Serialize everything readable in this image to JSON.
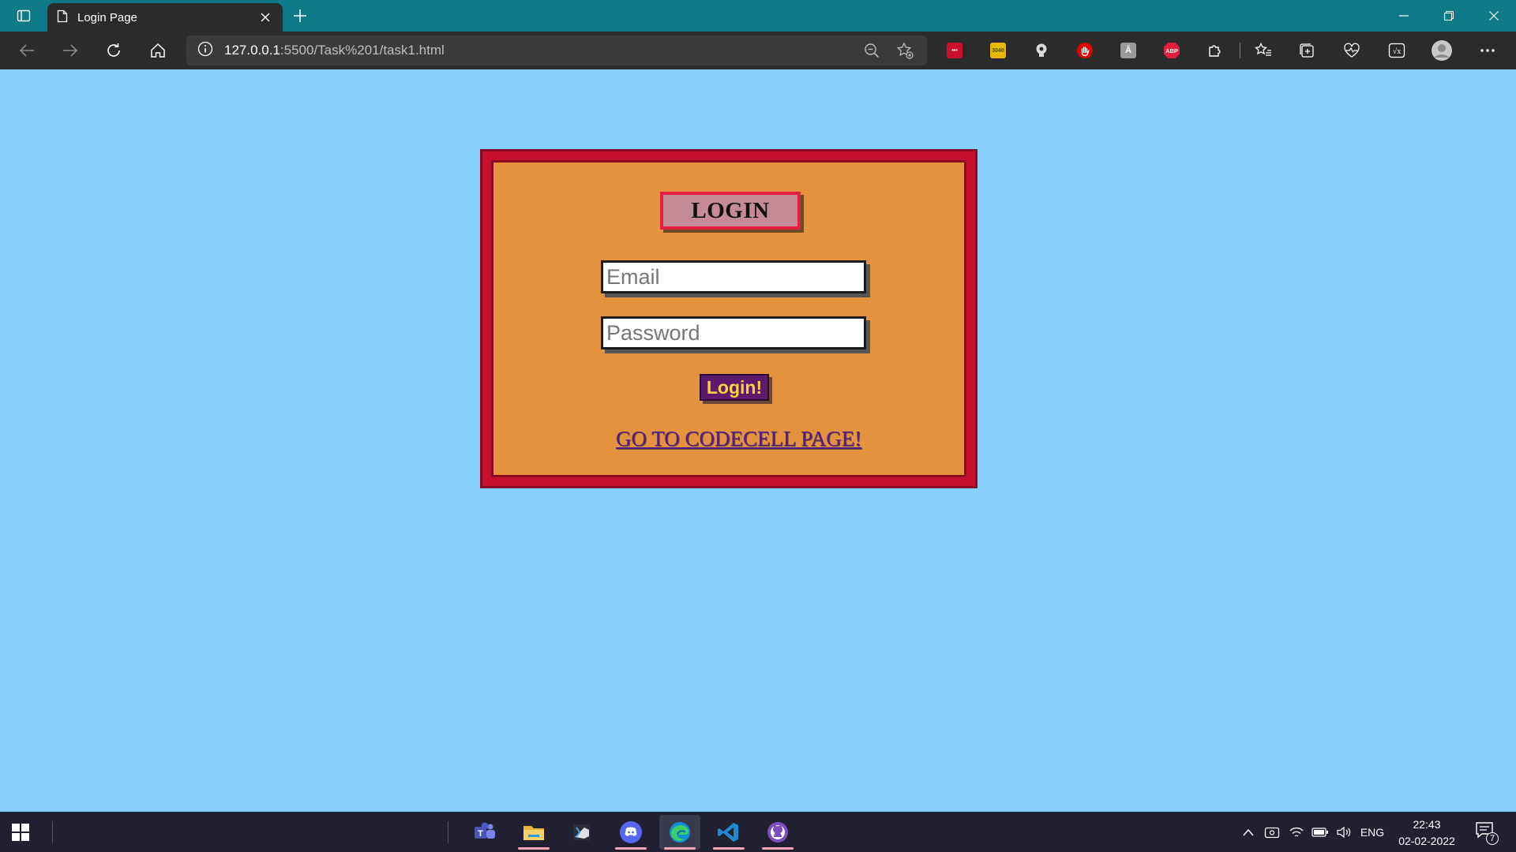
{
  "browser": {
    "tab_title": "Login Page",
    "url_host": "127.0.0.1",
    "url_rest": ":5500/Task%201/task1.html",
    "theme_color": "#0e7a87"
  },
  "extensions": [
    {
      "name": "extension-red-icon",
      "label": "•••",
      "color": "#c8102e"
    },
    {
      "name": "extension-yellow-icon",
      "label": "3040",
      "color": "#e6b800"
    },
    {
      "name": "extension-bulb-icon",
      "label": "",
      "color": "#cfcfcf"
    },
    {
      "name": "extension-hand-icon",
      "label": "",
      "color": "#e00000"
    },
    {
      "name": "extension-translate-icon",
      "label": "A",
      "color": "#9a9a9a"
    },
    {
      "name": "extension-adblock-icon",
      "label": "ABP",
      "color": "#e0203a"
    }
  ],
  "login": {
    "title": "LOGIN",
    "email_placeholder": "Email",
    "password_placeholder": "Password",
    "button_label": "Login!",
    "link_text": "GO TO CODECELL PAGE!",
    "colors": {
      "page_bg": "#87CEFA",
      "box_bg": "#E4923D",
      "box_border": "#c8102e",
      "button_bg": "#5b1a6e",
      "button_text": "#f6d33c"
    }
  },
  "taskbar": {
    "apps": [
      "teams-icon",
      "file-explorer-icon",
      "vs-icon",
      "discord-icon",
      "edge-icon",
      "vscode-icon",
      "github-desktop-icon"
    ],
    "language": "ENG",
    "time": "22:43",
    "date": "02-02-2022",
    "notification_count": "7"
  }
}
